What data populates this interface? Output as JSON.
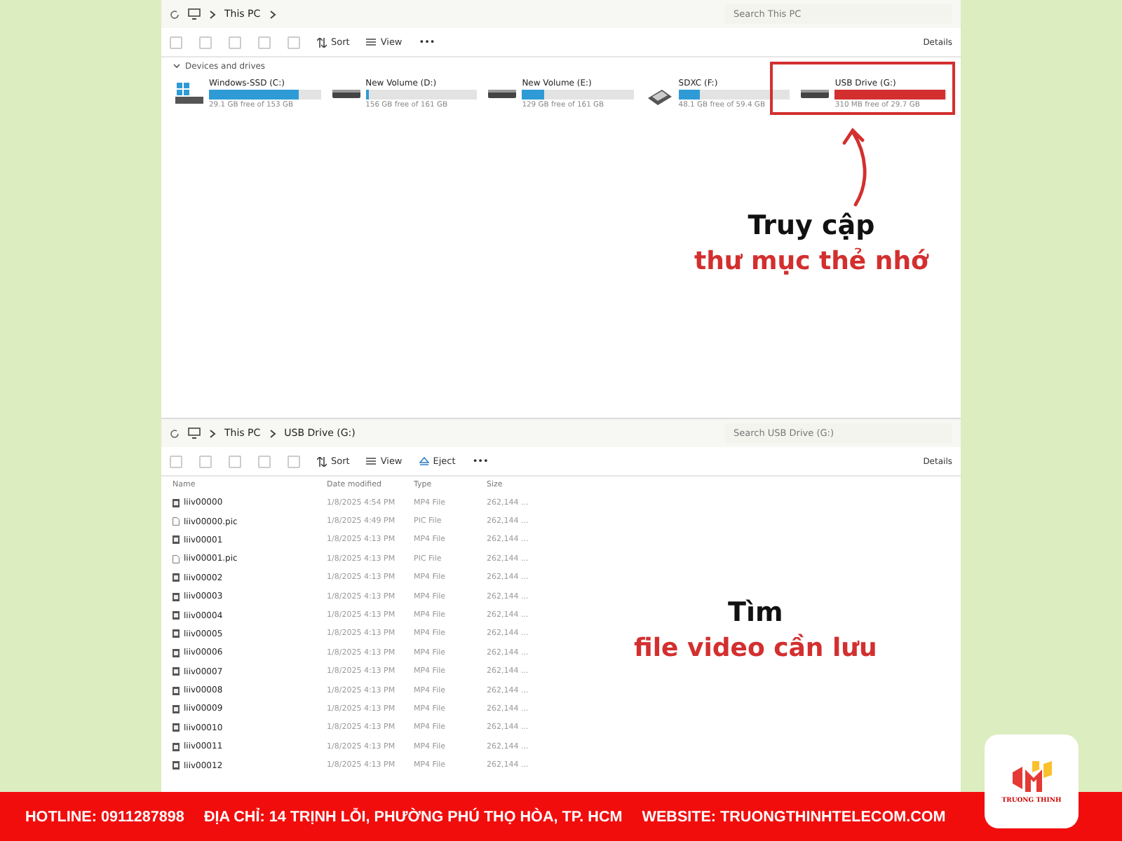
{
  "explorer_top": {
    "path": [
      "This PC"
    ],
    "search": {
      "placeholder": "Search This PC"
    },
    "toolbar": [
      {
        "kind": "sort",
        "label": "Sort"
      },
      {
        "kind": "view",
        "label": "View"
      },
      {
        "kind": "more",
        "label": "•••"
      }
    ],
    "details": "Details",
    "group": "Devices and drives",
    "drives": [
      {
        "kind": "windows",
        "name": "Windows-SSD (C:)",
        "free": "29.1 GB free of 153 GB",
        "level": 0.81,
        "color": "#2f9bd6",
        "highlighted": false
      },
      {
        "kind": "hdd",
        "name": "New Volume (D:)",
        "free": "156 GB free of 161 GB",
        "level": 0.03,
        "color": "#2f9bd6",
        "highlighted": false
      },
      {
        "kind": "hdd",
        "name": "New Volume (E:)",
        "free": "129 GB free of 161 GB",
        "level": 0.2,
        "color": "#2f9bd6",
        "highlighted": false
      },
      {
        "kind": "sd",
        "name": "SDXC (F:)",
        "free": "48.1 GB free of 59.4 GB",
        "level": 0.19,
        "color": "#2f9bd6",
        "highlighted": false
      },
      {
        "kind": "hdd",
        "name": "USB Drive (G:)",
        "free": "310 MB free of 29.7 GB",
        "level": 0.99,
        "color": "#d32f2f",
        "highlighted": true
      }
    ]
  },
  "annotation_1": {
    "line_1": "Truy cập",
    "line_2": "thư mục thẻ nhớ"
  },
  "explorer_bottom": {
    "path": [
      "This PC",
      "USB Drive (G:)"
    ],
    "search": {
      "placeholder": "Search USB Drive (G:)"
    },
    "toolbar": [
      {
        "kind": "sort",
        "label": "Sort"
      },
      {
        "kind": "view",
        "label": "View"
      },
      {
        "kind": "eject",
        "label": "Eject"
      },
      {
        "kind": "more",
        "label": "•••"
      }
    ],
    "details": "Details",
    "columns": [
      "Name",
      "Date modified",
      "Type",
      "Size"
    ],
    "rows": [
      {
        "kind": "video",
        "name": "liiv00000",
        "date": "1/8/2025 4:54 PM",
        "type": "MP4 File",
        "size": "262,144 ..."
      },
      {
        "kind": "file",
        "name": "liiv00000.pic",
        "date": "1/8/2025 4:49 PM",
        "type": "PIC File",
        "size": "262,144 ..."
      },
      {
        "kind": "video",
        "name": "liiv00001",
        "date": "1/8/2025 4:13 PM",
        "type": "MP4 File",
        "size": "262,144 ..."
      },
      {
        "kind": "file",
        "name": "liiv00001.pic",
        "date": "1/8/2025 4:13 PM",
        "type": "PIC File",
        "size": "262,144 ..."
      },
      {
        "kind": "video",
        "name": "liiv00002",
        "date": "1/8/2025 4:13 PM",
        "type": "MP4 File",
        "size": "262,144 ..."
      },
      {
        "kind": "video",
        "name": "liiv00003",
        "date": "1/8/2025 4:13 PM",
        "type": "MP4 File",
        "size": "262,144 ..."
      },
      {
        "kind": "video",
        "name": "liiv00004",
        "date": "1/8/2025 4:13 PM",
        "type": "MP4 File",
        "size": "262,144 ..."
      },
      {
        "kind": "video",
        "name": "liiv00005",
        "date": "1/8/2025 4:13 PM",
        "type": "MP4 File",
        "size": "262,144 ..."
      },
      {
        "kind": "video",
        "name": "liiv00006",
        "date": "1/8/2025 4:13 PM",
        "type": "MP4 File",
        "size": "262,144 ..."
      },
      {
        "kind": "video",
        "name": "liiv00007",
        "date": "1/8/2025 4:13 PM",
        "type": "MP4 File",
        "size": "262,144 ..."
      },
      {
        "kind": "video",
        "name": "liiv00008",
        "date": "1/8/2025 4:13 PM",
        "type": "MP4 File",
        "size": "262,144 ..."
      },
      {
        "kind": "video",
        "name": "liiv00009",
        "date": "1/8/2025 4:13 PM",
        "type": "MP4 File",
        "size": "262,144 ..."
      },
      {
        "kind": "video",
        "name": "liiv00010",
        "date": "1/8/2025 4:13 PM",
        "type": "MP4 File",
        "size": "262,144 ..."
      },
      {
        "kind": "video",
        "name": "liiv00011",
        "date": "1/8/2025 4:13 PM",
        "type": "MP4 File",
        "size": "262,144 ..."
      },
      {
        "kind": "video",
        "name": "liiv00012",
        "date": "1/8/2025 4:13 PM",
        "type": "MP4 File",
        "size": "262,144 ..."
      }
    ]
  },
  "annotation_2": {
    "line_1": "Tìm",
    "line_2": "file video cần lưu"
  },
  "footer": [
    "HOTLINE: 0911287898",
    "ĐỊA CHỈ: 14 TRỊNH LỖI, PHƯỜNG PHÚ THỌ HÒA, TP. HCM",
    "WEBSITE: TRUONGTHINHTELECOM.COM"
  ],
  "logo": {
    "text": "TRUONG THINH"
  }
}
